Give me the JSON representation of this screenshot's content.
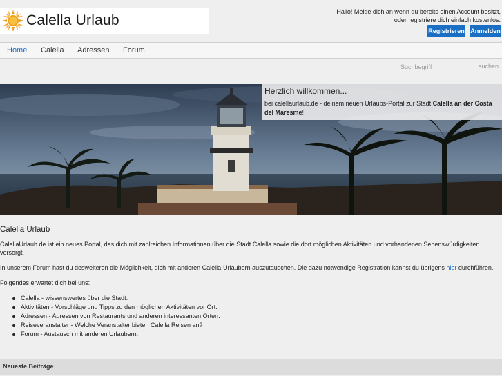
{
  "header": {
    "logo_text": "Calella Urlaub",
    "welcome_line1": "Hallo! Melde dich an wenn du bereits einen Account besitzt,",
    "welcome_line2": "oder registriere dich einfach kostenlos.",
    "register_label": "Registrieren",
    "login_label": "Anmelden"
  },
  "nav": {
    "items": [
      {
        "label": "Home",
        "active": true
      },
      {
        "label": "Calella",
        "active": false
      },
      {
        "label": "Adressen",
        "active": false
      },
      {
        "label": "Forum",
        "active": false
      }
    ]
  },
  "search": {
    "placeholder": "Suchbegriff",
    "button_label": "suchen"
  },
  "hero": {
    "title": "Herzlich willkommen...",
    "text_before": "bei calellaurlaub.de - deinem neuen Urlaubs-Portal zur Stadt ",
    "text_bold": "Calella an der Costa del Maresme",
    "text_after": "!"
  },
  "main": {
    "heading": "Calella Urlaub",
    "para1": "CalellaUrlaub.de ist ein neues Portal, das dich mit zahlreichen Informationen über die Stadt Calella sowie die dort möglichen Aktivitäten und vorhandenen Sehenswürdigkeiten versorgt.",
    "para2_text": "In unserem Forum hast du desweiteren die Möglichkeit, dich mit anderen Calella-Urlaubern auszutauschen. Die dazu notwendige Registration kannst du übrigens ",
    "para2_link": "hier",
    "para2_after": " durchführen.",
    "para3": "Folgendes erwartet dich bei uns:",
    "features": [
      "Calella - wissenswertes über die Stadt.",
      "Aktivitäten - Vorschläge und Tipps zu den möglichen Aktivitäten vor Ort.",
      "Adressen - Adressen von Restaurants und anderen interessanten Orten.",
      "Reiseveranstalter - Welche Veranstalter bieten Calella Reisen an?",
      "Forum - Austausch mit anderen Urlaubern."
    ]
  },
  "newest": {
    "title": "Neueste Beiträge"
  },
  "colors": {
    "accent": "#1a6fc4",
    "background": "#efefef"
  }
}
